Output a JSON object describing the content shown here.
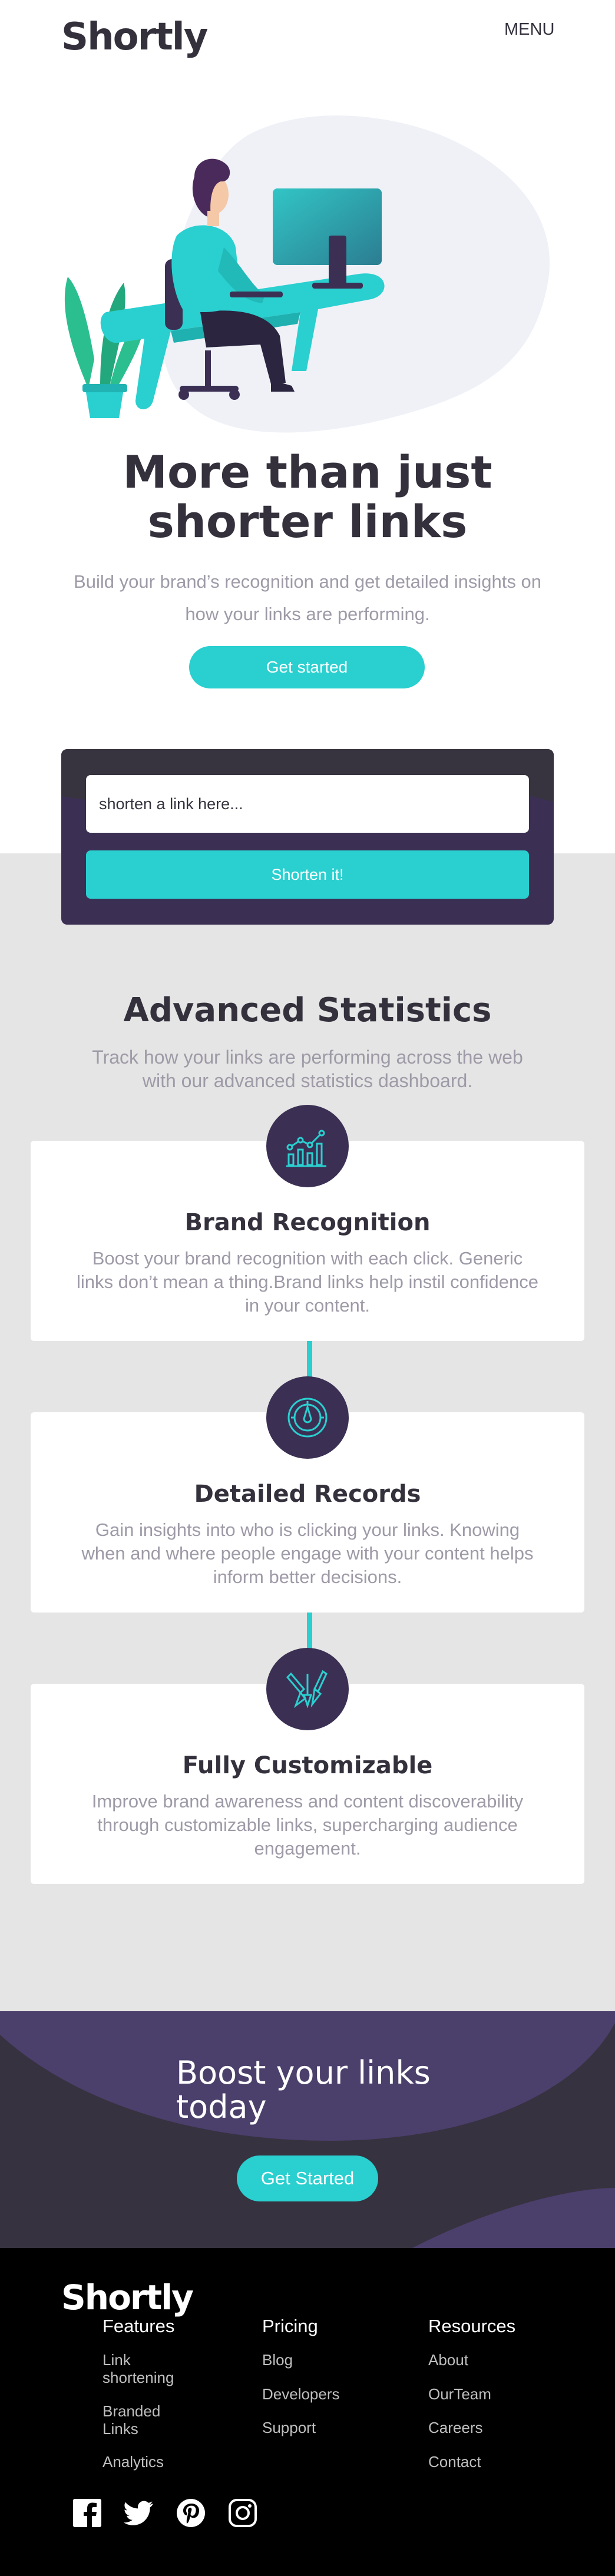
{
  "header": {
    "logo": "Shortly",
    "menu_label": "MENU"
  },
  "hero": {
    "title_line1": "More than just",
    "title_line2": "shorter links",
    "subtitle_line1": "Build your brand’s recognition and get detailed insights on",
    "subtitle_line2": "how your links are performing.",
    "cta_label": "Get started"
  },
  "shorten": {
    "input_placeholder": "shorten a link here...",
    "button_label": "Shorten it!"
  },
  "stats": {
    "title": "Advanced Statistics",
    "subtitle_line1": "Track how your links are performing across the web",
    "subtitle_line2": "with our advanced statistics dashboard.",
    "cards": [
      {
        "icon": "brand-recognition-icon",
        "title": "Brand Recognition",
        "text_line1": "Boost your brand recognition with each click. Generic",
        "text_line2": "links don’t mean a thing.Brand links help instil confidence",
        "text_line3": "in your content."
      },
      {
        "icon": "detailed-records-icon",
        "title": "Detailed Records",
        "text_line1": "Gain insights into who is clicking your links. Knowing",
        "text_line2": "when and where people engage with your content helps",
        "text_line3": "inform better decisions."
      },
      {
        "icon": "fully-customizable-icon",
        "title": "Fully Customizable",
        "text_line1": "Improve brand awareness and content discoverability",
        "text_line2": "through customizable links, supercharging audience",
        "text_line3": "engagement."
      }
    ]
  },
  "boost": {
    "title_line1": "Boost your links",
    "title_line2": "today",
    "cta_label": "Get Started"
  },
  "footer": {
    "logo": "Shortly",
    "columns": [
      {
        "heading": "Features",
        "links": [
          "Link shortening",
          "Branded Links",
          "Analytics"
        ]
      },
      {
        "heading": "Pricing",
        "links": [
          "Blog",
          "Developers",
          "Support"
        ]
      },
      {
        "heading": "Resources",
        "links": [
          "About",
          "OurTeam",
          "Careers",
          "Contact"
        ]
      }
    ],
    "social": [
      "facebook-icon",
      "twitter-icon",
      "pinterest-icon",
      "instagram-icon"
    ]
  },
  "colors": {
    "primary_cyan": "#2acfcf",
    "dark_violet": "#3b3054",
    "very_dark_blue": "#34313d",
    "grayish_violet": "#9e9aa7",
    "light_gray": "#e5e5e5"
  }
}
